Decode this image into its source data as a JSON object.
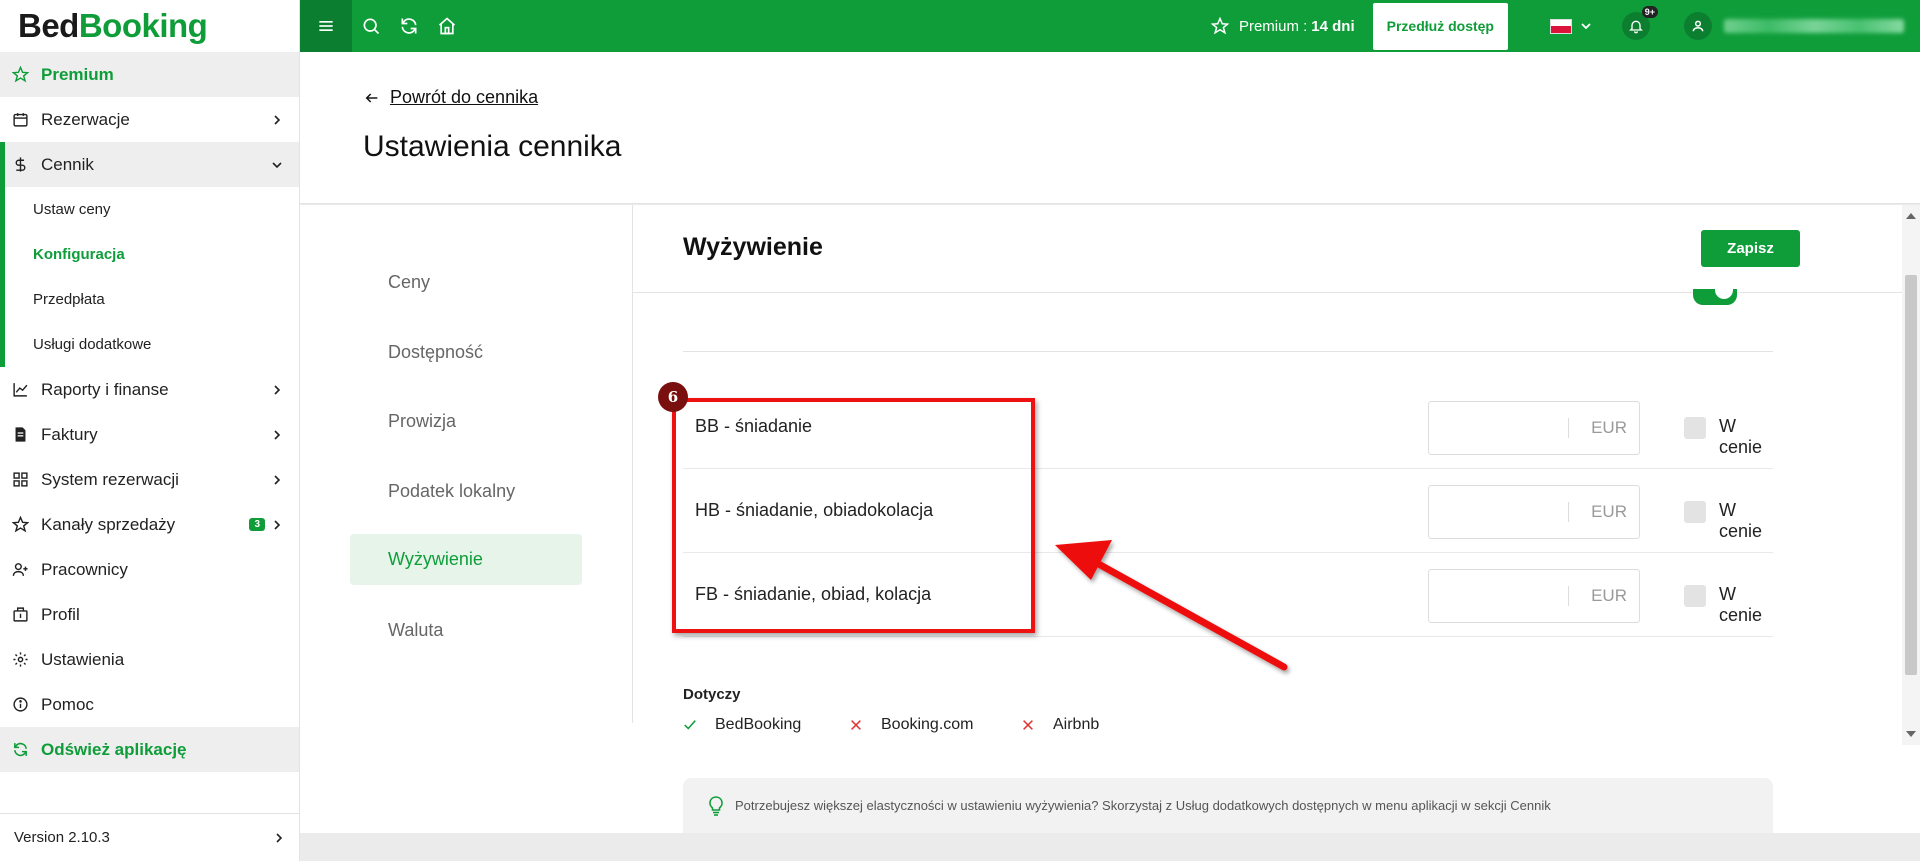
{
  "brand": {
    "part1": "Bed",
    "part2": "Booking"
  },
  "sidebar": {
    "items": [
      {
        "label": "Premium"
      },
      {
        "label": "Rezerwacje"
      },
      {
        "label": "Cennik"
      },
      {
        "label": "Raporty i finanse"
      },
      {
        "label": "Faktury"
      },
      {
        "label": "System rezerwacji"
      },
      {
        "label": "Kanały sprzedaży",
        "badge": "3"
      },
      {
        "label": "Pracownicy"
      },
      {
        "label": "Profil"
      },
      {
        "label": "Ustawienia"
      },
      {
        "label": "Pomoc"
      },
      {
        "label": "Odśwież aplikację"
      }
    ],
    "sub_items": [
      {
        "label": "Ustaw ceny"
      },
      {
        "label": "Konfiguracja"
      },
      {
        "label": "Przedpłata"
      },
      {
        "label": "Usługi dodatkowe"
      }
    ],
    "version": "Version 2.10.3"
  },
  "topbar": {
    "premium_label": "Premium :",
    "premium_days": "14 dni",
    "extend_label": "Przedłuż dostęp",
    "notifications_count": "9+"
  },
  "header": {
    "back_label": "Powrót do cennika",
    "title": "Ustawienia cennika"
  },
  "tabs": [
    {
      "label": "Ceny"
    },
    {
      "label": "Dostępność"
    },
    {
      "label": "Prowizja"
    },
    {
      "label": "Podatek lokalny"
    },
    {
      "label": "Wyżywienie"
    },
    {
      "label": "Waluta"
    }
  ],
  "panel": {
    "title": "Wyżywienie",
    "save_label": "Zapisz",
    "meals": [
      {
        "name": "BB - śniadanie",
        "currency": "EUR",
        "included_label": "W cenie"
      },
      {
        "name": "HB - śniadanie, obiadokolacja",
        "currency": "EUR",
        "included_label": "W cenie"
      },
      {
        "name": "FB - śniadanie, obiad, kolacja",
        "currency": "EUR",
        "included_label": "W cenie"
      }
    ],
    "applies_label": "Dotyczy",
    "channels": [
      {
        "name": "BedBooking",
        "enabled": true
      },
      {
        "name": "Booking.com",
        "enabled": false
      },
      {
        "name": "Airbnb",
        "enabled": false
      }
    ],
    "tip": "Potrzebujesz większej elastyczności w ustawieniu wyżywienia? Skorzystaj z Usług dodatkowych dostępnych w menu aplikacji w sekcji Cennik"
  },
  "annotation": {
    "number": "6"
  },
  "colors": {
    "brand_green": "#0f9d3a",
    "annotation_red": "#e11111"
  }
}
